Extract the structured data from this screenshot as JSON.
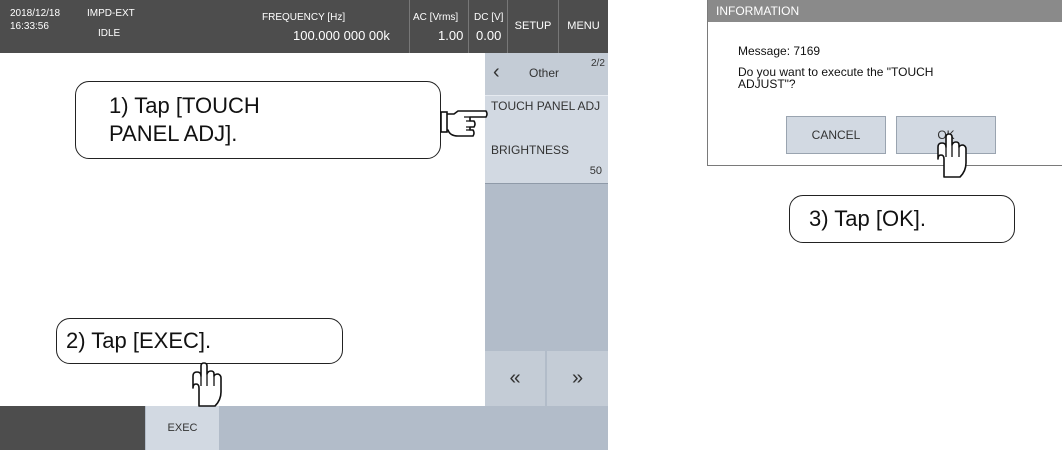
{
  "screen": {
    "topbar": {
      "date": "2018/12/18",
      "time": "16:33:56",
      "source": "IMPD-EXT",
      "status": "IDLE",
      "freq_label": "FREQUENCY [Hz]",
      "freq_value": "100.000 000 00k",
      "ac_label": "AC [Vrms]",
      "ac_value": "1.00",
      "dc_label": "DC [V]",
      "dc_value": "0.00",
      "setup": "SETUP",
      "menu": "MENU"
    },
    "side": {
      "back_icon": "chevron-left-icon",
      "title": "Other",
      "page": "2/2",
      "item1": "TOUCH PANEL ADJ",
      "item2": "BRIGHTNESS",
      "item2_value": "50",
      "prev": "«",
      "next": "»"
    },
    "bottom": {
      "exec": "EXEC"
    }
  },
  "callouts": {
    "step1": "1) Tap [TOUCH PANEL ADJ].",
    "step2": "2) Tap [EXEC].",
    "step3": "3) Tap [OK]."
  },
  "dialog": {
    "title": "INFORMATION",
    "message": "Message: 7169",
    "question": "Do you want to execute the \"TOUCH ADJUST\"?",
    "cancel": "CANCEL",
    "ok": "OK"
  },
  "icons": [
    "pointing-hand-icon",
    "tapping-hand-icon"
  ],
  "colors": {
    "bar_dark": "#4d4d4d",
    "panel": "#b2bcc9",
    "button": "#d2d9e2"
  }
}
